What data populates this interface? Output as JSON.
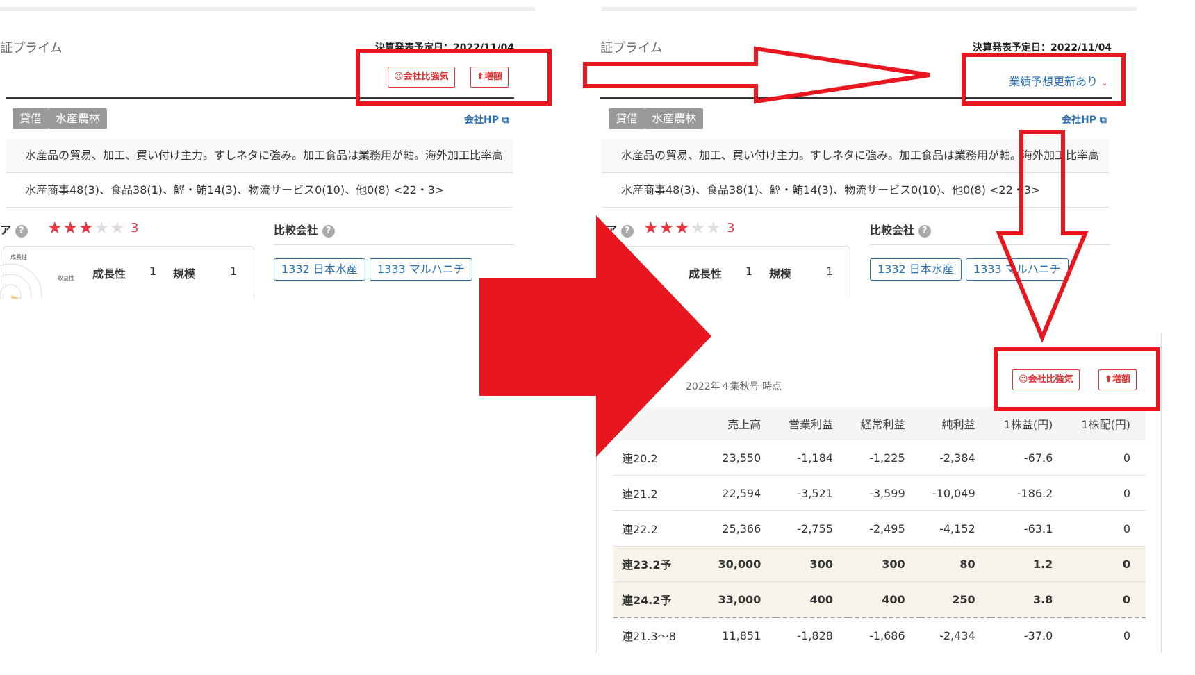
{
  "left": {
    "market": "証プライム",
    "settlement": "決算発表予定日：2022/11/04",
    "buttons": {
      "strong": "会社比強気",
      "increase": "増額"
    },
    "tags": [
      "貸借",
      "水産農林"
    ],
    "hp": "会社HP",
    "desc1": "水産品の貿易、加工、買い付け主力。すしネタに強み。加工食品は業務用が軸。海外加工比率高い",
    "desc2": "水産商事48(3)、食品38(1)、鰹・鮪14(3)、物流サービス0(10)、他0(8) <22・3>",
    "score_label": "ア",
    "score_value": "3",
    "score_stars": 3,
    "radar_labels": [
      "成長性",
      "収益性"
    ],
    "metrics": [
      {
        "name": "成長性",
        "value": "1"
      },
      {
        "name": "規模",
        "value": "1"
      }
    ],
    "compare_title": "比較会社",
    "compare": [
      "1332 日本水産",
      "1333 マルハニチ"
    ]
  },
  "right": {
    "market": "証プライム",
    "settlement": "決算発表予定日：2022/11/04",
    "update_link": "業績予想更新あり",
    "tags": [
      "貸借",
      "水産農林"
    ],
    "hp": "会社HP",
    "desc1": "水産品の貿易、加工、買い付け主力。すしネタに強み。加工食品は業務用が軸。海外加工比率高い",
    "desc2": "水産商事48(3)、食品38(1)、鰹・鮪14(3)、物流サービス0(10)、他0(8) <22・3>",
    "score_label": "ア",
    "score_value": "3",
    "score_stars": 3,
    "metrics": [
      {
        "name": "成長性",
        "value": "1"
      },
      {
        "name": "規模",
        "value": "1"
      }
    ],
    "compare_title": "比較会社",
    "compare": [
      "1332 日本水産",
      "1333 マルハニチ"
    ]
  },
  "table_panel": {
    "as_of": "2022年４集秋号 時点",
    "buttons": {
      "strong": "会社比強気",
      "increase": "増額"
    },
    "headers": [
      "",
      "売上高",
      "営業利益",
      "経常利益",
      "純利益",
      "1株益(円)",
      "1株配(円)"
    ],
    "rows": [
      [
        "連20.2",
        "23,550",
        "-1,184",
        "-1,225",
        "-2,384",
        "-67.6",
        "0"
      ],
      [
        "連21.2",
        "22,594",
        "-3,521",
        "-3,599",
        "-10,049",
        "-186.2",
        "0"
      ],
      [
        "連22.2",
        "25,366",
        "-2,755",
        "-2,495",
        "-4,152",
        "-63.1",
        "0"
      ],
      [
        "連23.2予",
        "30,000",
        "300",
        "300",
        "80",
        "1.2",
        "0"
      ],
      [
        "連24.2予",
        "33,000",
        "400",
        "400",
        "250",
        "3.8",
        "0"
      ],
      [
        "連21.3〜8",
        "11,851",
        "-1,828",
        "-1,686",
        "-2,434",
        "-37.0",
        "0"
      ]
    ]
  },
  "colors": {
    "annotation_red": "#e8161f",
    "link_blue": "#2a6fb0",
    "star_red": "#e6373f"
  }
}
